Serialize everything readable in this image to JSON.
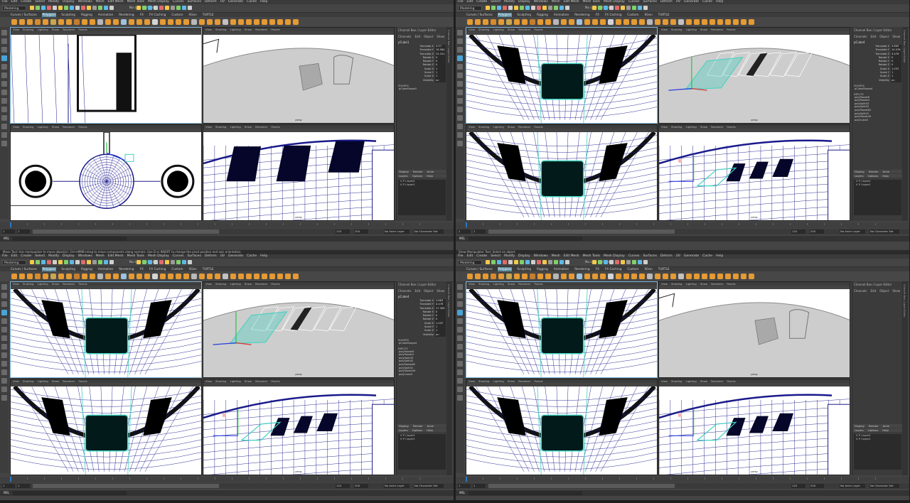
{
  "menu": [
    "File",
    "Edit",
    "Create",
    "Select",
    "Modify",
    "Display",
    "Windows",
    "Mesh",
    "Edit Mesh",
    "Mesh Tools",
    "Mesh Display",
    "Curves",
    "Surfaces",
    "Deform",
    "UV",
    "Generate",
    "Cache",
    "Help"
  ],
  "mode_select": "Modeling",
  "live_surface": "No Live Surface",
  "shelf_tabs": [
    "Curves / Surfaces",
    "Polygons",
    "Sculpting",
    "Rigging",
    "Animation",
    "Rendering",
    "FX",
    "FX Caching",
    "Custom",
    "XGen",
    "TURTLE"
  ],
  "viewport_menu": [
    "View",
    "Shading",
    "Lighting",
    "Show",
    "Renderer",
    "Panels"
  ],
  "camera_label": "persp",
  "channel_box": {
    "header": "Channel Box / Layer Editor",
    "tabs": [
      "Channels",
      "Edit",
      "Object",
      "Show"
    ],
    "attributes": [
      "Translate X",
      "Translate Y",
      "Translate Z",
      "Rotate X",
      "Rotate Y",
      "Rotate Z",
      "Scale X",
      "Scale Y",
      "Scale Z",
      "Visibility"
    ],
    "shapes_label": "SHAPES",
    "inputs_label": "INPUTS"
  },
  "layer_editor": {
    "tabs": [
      "Display",
      "Render",
      "Anim"
    ],
    "menu": [
      "Layers",
      "Options",
      "Help"
    ],
    "layers": [
      "layer2",
      "layer1"
    ]
  },
  "side_tab": "Channel Box / Layer Editor",
  "timeline": {
    "start": "1",
    "current": "1",
    "end_inner": "120",
    "end_outer": "200",
    "anim_layer": "No Anim Layer",
    "char_set": "No Character Set",
    "ticks": [
      "1",
      "5",
      "10",
      "15",
      "20",
      "25",
      "30",
      "35",
      "40",
      "45",
      "50",
      "55",
      "60",
      "65",
      "70",
      "75",
      "80",
      "85",
      "90",
      "95",
      "100",
      "105",
      "110",
      "115",
      "120"
    ]
  },
  "mel_label": "MEL",
  "quadrants": [
    {
      "name": "q1",
      "status": "",
      "object": "pCube1",
      "values": [
        "3.97",
        "16.584",
        "22.101",
        "0",
        "0",
        "0",
        "1",
        "1",
        "1",
        "on"
      ],
      "shapes": [
        "pCubeShape2"
      ],
      "inputs": []
    },
    {
      "name": "q2",
      "status": "",
      "object": "pCube4",
      "values": [
        "3.863",
        "14.576",
        "3.476",
        "0",
        "0",
        "0",
        "1.037",
        "1",
        "1",
        "on"
      ],
      "shapes": [
        "pCubeShape4"
      ],
      "inputs": [
        "polyTweak8",
        "polyTweak4",
        "polySplit43",
        "polySplit42",
        "polyTweak62",
        "polySplit41",
        "polyTweak49",
        "polyCube3"
      ]
    },
    {
      "name": "q3",
      "status": "Move Tool: Use manipulator to move object(s). Ctrl+MMB+drag to move components along normals. Use D or INSERT to change the pivot position and axis orientation.",
      "object": "pCube4",
      "values": [
        "3.863",
        "4.476",
        "17.396",
        "0",
        "0",
        "0",
        "1.037",
        "1",
        "1",
        "on"
      ],
      "shapes": [
        "pCubeShape4"
      ],
      "inputs": [
        "polyTweak8",
        "polyTweak4",
        "polySplit43",
        "polySplit42",
        "polyTweak62",
        "polySplit41",
        "polyTweak49",
        "polyCube3"
      ]
    },
    {
      "name": "q4",
      "status": "Show Manipulator Tool: Select an object",
      "object": "",
      "values": [],
      "shapes": [],
      "inputs": []
    }
  ],
  "colors": {
    "ui_bg": "#444444",
    "selected_tab": "#5f8fa3",
    "wire": "#1a1a8c",
    "selection": "#3fd1c0",
    "manip_y": "#22c24a",
    "manip_x": "#e03030",
    "manip_z": "#2a3ce0"
  }
}
